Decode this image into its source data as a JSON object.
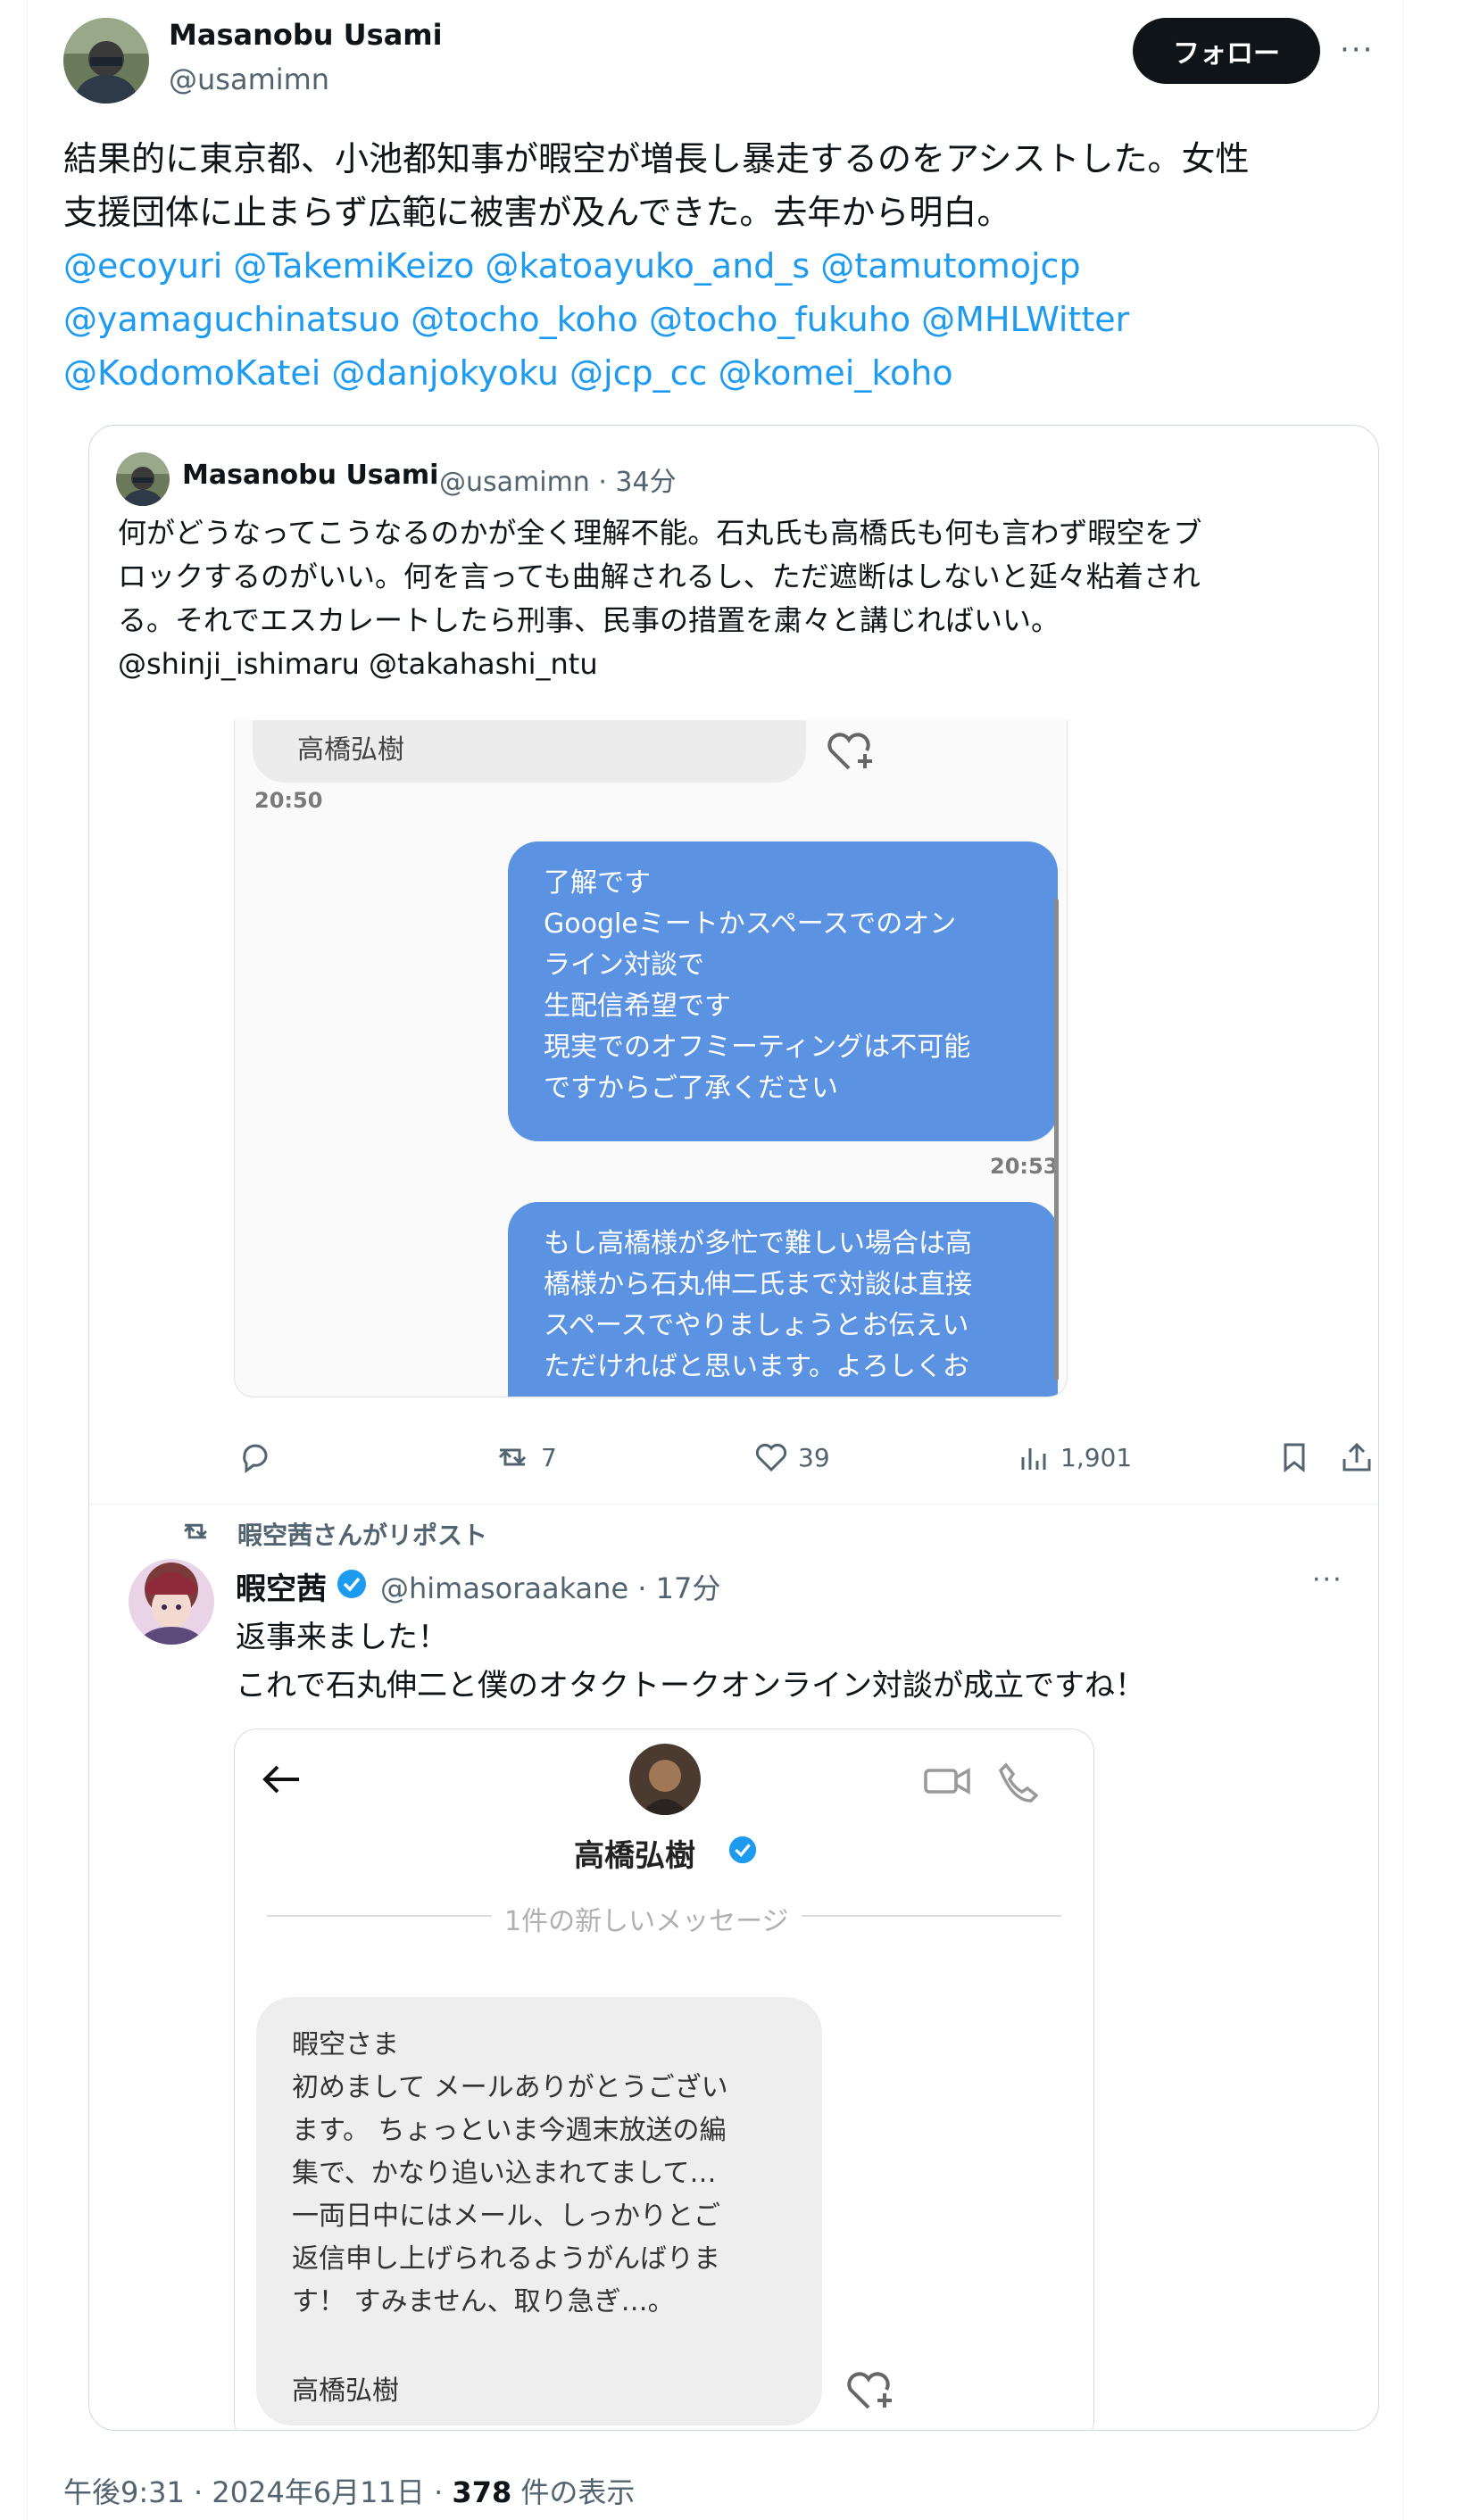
{
  "tweet": {
    "author_name": "Masanobu Usami",
    "author_handle": "@usamimn",
    "follow_label": "フォロー",
    "more_label": "···",
    "text_line1": "結果的に東京都、小池都知事が暇空が増長し暴走するのをアシストした。女性",
    "text_line2": "支援団体に止まらず広範に被害が及んできた。去年から明白。",
    "mentions_line1": "@ecoyuri @TakemiKeizo @katoayuko_and_s @tamutomojcp",
    "mentions_line2": "@yamaguchinatsuo @tocho_koho @tocho_fukuho @MHLWitter",
    "mentions_line3": "@KodomoKatei @danjokyoku @jcp_cc @komei_koho",
    "footer_time": "午後9:31 · 2024年6月11日 · ",
    "footer_views": "378",
    "footer_views_label": " 件の表示"
  },
  "quote": {
    "author_name": "Masanobu Usami",
    "author_handle": "@usamimn · 34分",
    "text_line1": "何がどうなってこうなるのかが全く理解不能。石丸氏も高橋氏も何も言わず暇空をブ",
    "text_line2": "ロックするのがいい。何を言っても曲解されるし、ただ遮断はしないと延々粘着され",
    "text_line3": "る。それでエスカレートしたら刑事、民事の措置を粛々と講じればいい。",
    "text_line4": "@shinji_ishimaru @takahashi_ntu",
    "screenshot": {
      "top_bubble_name": "高橋弘樹",
      "time1": "20:50",
      "msg1_lines": [
        "了解です",
        "Googleミートかスペースでのオン",
        "ライン対談で",
        "生配信希望です",
        "現実でのオフミーティングは不可能",
        "ですからご了承ください"
      ],
      "time2": "20:53",
      "msg2_lines": [
        "もし高橋様が多忙で難しい場合は高",
        "橋様から石丸伸二氏まで対談は直接",
        "スペースでやりましょうとお伝えい",
        "ただければと思います。よろしくお"
      ]
    },
    "actions": {
      "replies": "",
      "reposts": "7",
      "likes": "39",
      "views": "1,901"
    }
  },
  "repost": {
    "reposted_by": "暇空茜さんがリポスト",
    "author_name": "暇空茜",
    "author_handle": "@himasoraakane · 17分",
    "text_line1": "返事来ました！",
    "text_line2": "これで石丸伸二と僕のオタクトークオンライン対談が成立ですね！",
    "screenshot": {
      "contact_name": "高橋弘樹",
      "new_messages": "1件の新しいメッセージ",
      "msg_lines": [
        "暇空さま",
        "初めまして メールありがとうござい",
        "ます。 ちょっといま今週末放送の編",
        "集で、かなり追い込まれてまして…",
        "一両日中にはメール、しっかりとご",
        "返信申し上げられるようがんばりま",
        "す！ すみません、取り急ぎ…。"
      ],
      "msg_signature": "高橋弘樹"
    }
  },
  "colors": {
    "link": "#1d9bf0",
    "verified": "#1d9bf0",
    "bubble": "#5b93e2"
  }
}
